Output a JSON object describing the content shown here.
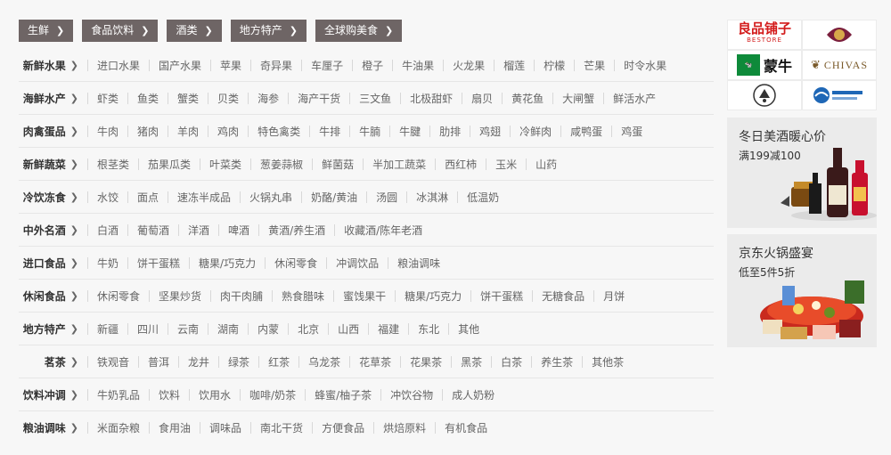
{
  "tags": [
    {
      "label": "生鲜"
    },
    {
      "label": "食品饮料"
    },
    {
      "label": "酒类"
    },
    {
      "label": "地方特产"
    },
    {
      "label": "全球购美食"
    }
  ],
  "categories": [
    {
      "title": "新鲜水果",
      "items": [
        "进口水果",
        "国产水果",
        "苹果",
        "奇异果",
        "车厘子",
        "橙子",
        "牛油果",
        "火龙果",
        "榴莲",
        "柠檬",
        "芒果",
        "时令水果"
      ]
    },
    {
      "title": "海鲜水产",
      "items": [
        "虾类",
        "鱼类",
        "蟹类",
        "贝类",
        "海参",
        "海产干货",
        "三文鱼",
        "北极甜虾",
        "扇贝",
        "黄花鱼",
        "大闸蟹",
        "鲜活水产"
      ]
    },
    {
      "title": "肉禽蛋品",
      "items": [
        "牛肉",
        "猪肉",
        "羊肉",
        "鸡肉",
        "特色禽类",
        "牛排",
        "牛腩",
        "牛腱",
        "肋排",
        "鸡翅",
        "冷鲜肉",
        "咸鸭蛋",
        "鸡蛋"
      ]
    },
    {
      "title": "新鲜蔬菜",
      "items": [
        "根茎类",
        "茄果瓜类",
        "叶菜类",
        "葱姜蒜椒",
        "鲜菌菇",
        "半加工蔬菜",
        "西红柿",
        "玉米",
        "山药"
      ]
    },
    {
      "title": "冷饮冻食",
      "items": [
        "水饺",
        "面点",
        "速冻半成品",
        "火锅丸串",
        "奶酪/黄油",
        "汤圆",
        "冰淇淋",
        "低温奶"
      ]
    },
    {
      "title": "中外名酒",
      "items": [
        "白酒",
        "葡萄酒",
        "洋酒",
        "啤酒",
        "黄酒/养生酒",
        "收藏酒/陈年老酒"
      ]
    },
    {
      "title": "进口食品",
      "items": [
        "牛奶",
        "饼干蛋糕",
        "糖果/巧克力",
        "休闲零食",
        "冲调饮品",
        "粮油调味"
      ]
    },
    {
      "title": "休闲食品",
      "items": [
        "休闲零食",
        "坚果炒货",
        "肉干肉脯",
        "熟食腊味",
        "蜜饯果干",
        "糖果/巧克力",
        "饼干蛋糕",
        "无糖食品",
        "月饼"
      ]
    },
    {
      "title": "地方特产",
      "items": [
        "新疆",
        "四川",
        "云南",
        "湖南",
        "内蒙",
        "北京",
        "山西",
        "福建",
        "东北",
        "其他"
      ]
    },
    {
      "title": "茗茶",
      "items": [
        "铁观音",
        "普洱",
        "龙井",
        "绿茶",
        "红茶",
        "乌龙茶",
        "花草茶",
        "花果茶",
        "黑茶",
        "白茶",
        "养生茶",
        "其他茶"
      ]
    },
    {
      "title": "饮料冲调",
      "items": [
        "牛奶乳品",
        "饮料",
        "饮用水",
        "咖啡/奶茶",
        "蜂蜜/柚子茶",
        "冲饮谷物",
        "成人奶粉"
      ]
    },
    {
      "title": "粮油调味",
      "items": [
        "米面杂粮",
        "食用油",
        "调味品",
        "南北干货",
        "方便食品",
        "烘焙原料",
        "有机食品"
      ]
    }
  ],
  "brands": {
    "liangpin": {
      "name": "良品铺子",
      "sub": "BESTORE"
    },
    "niu_sub": "蒙牛",
    "chivas": "CHIVAS"
  },
  "promos": [
    {
      "title": "冬日美酒暖心价",
      "subtitle": "满199减100"
    },
    {
      "title": "京东火锅盛宴",
      "subtitle": "低至5件5折"
    }
  ]
}
